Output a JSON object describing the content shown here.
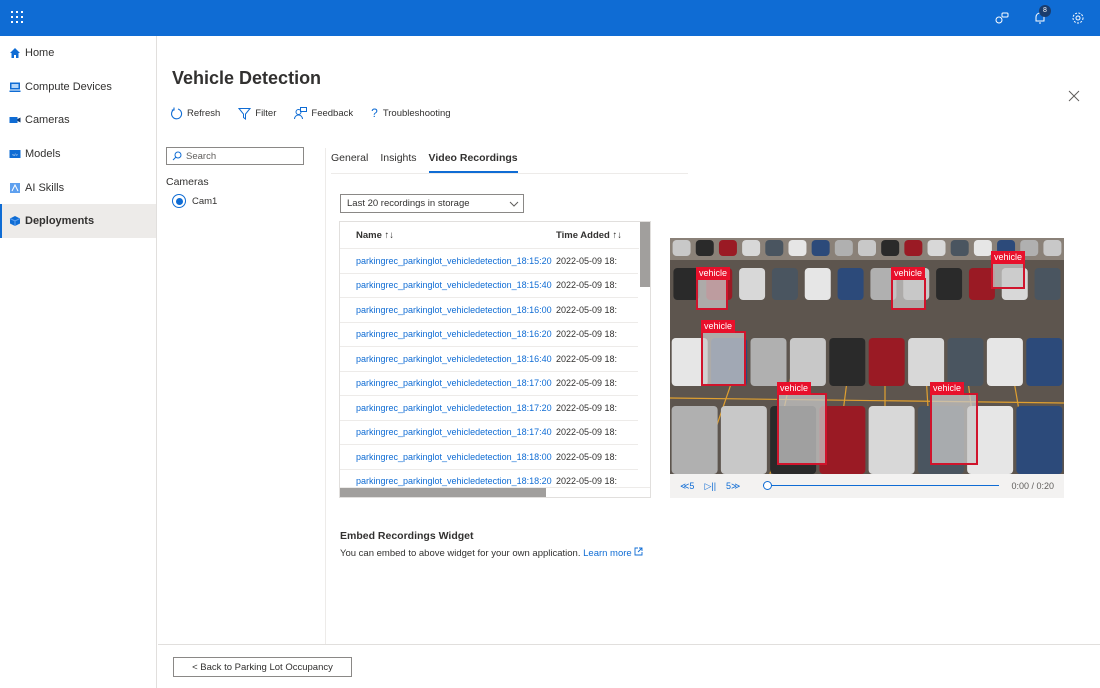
{
  "topbar": {
    "waffle_icon": "app-launcher-icon",
    "icons": [
      "chat-icon",
      "notification-bell-icon",
      "gear-icon"
    ],
    "notification_count": "8",
    "accent": "#0f6cd4"
  },
  "sidebar": {
    "items": [
      {
        "label": "Home",
        "icon": "home-icon",
        "active": false
      },
      {
        "label": "Compute Devices",
        "icon": "compute-device-icon",
        "active": false
      },
      {
        "label": "Cameras",
        "icon": "camera-icon",
        "active": false
      },
      {
        "label": "Models",
        "icon": "model-icon",
        "active": false
      },
      {
        "label": "AI Skills",
        "icon": "ai-skills-icon",
        "active": false
      },
      {
        "label": "Deployments",
        "icon": "deployments-icon",
        "active": true
      }
    ]
  },
  "page": {
    "title": "Vehicle Detection",
    "toolbar": {
      "refresh": "Refresh",
      "filter": "Filter",
      "feedback": "Feedback",
      "troubleshooting": "Troubleshooting"
    }
  },
  "left_panel": {
    "search_placeholder": "Search",
    "cameras_label": "Cameras",
    "cameras": [
      {
        "name": "Cam1",
        "selected": true
      }
    ]
  },
  "tabs": [
    {
      "label": "General",
      "active": false
    },
    {
      "label": "Insights",
      "active": false
    },
    {
      "label": "Video Recordings",
      "active": true
    }
  ],
  "recordings": {
    "filter_selected": "Last 20 recordings in storage",
    "columns": {
      "name": "Name ↑↓",
      "time": "Time Added ↑↓"
    },
    "rows": [
      {
        "name": "parkingrec_parkinglot_vehicledetection_18:15:20",
        "time": "2022-05-09 18:"
      },
      {
        "name": "parkingrec_parkinglot_vehicledetection_18:15:40",
        "time": "2022-05-09 18:"
      },
      {
        "name": "parkingrec_parkinglot_vehicledetection_18:16:00",
        "time": "2022-05-09 18:"
      },
      {
        "name": "parkingrec_parkinglot_vehicledetection_18:16:20",
        "time": "2022-05-09 18:"
      },
      {
        "name": "parkingrec_parkinglot_vehicledetection_18:16:40",
        "time": "2022-05-09 18:"
      },
      {
        "name": "parkingrec_parkinglot_vehicledetection_18:17:00",
        "time": "2022-05-09 18:"
      },
      {
        "name": "parkingrec_parkinglot_vehicledetection_18:17:20",
        "time": "2022-05-09 18:"
      },
      {
        "name": "parkingrec_parkinglot_vehicledetection_18:17:40",
        "time": "2022-05-09 18:"
      },
      {
        "name": "parkingrec_parkinglot_vehicledetection_18:18:00",
        "time": "2022-05-09 18:"
      },
      {
        "name": "parkingrec_parkinglot_vehicledetection_18:18:20",
        "time": "2022-05-09 18:"
      }
    ]
  },
  "video": {
    "detection_label": "vehicle",
    "detection_count": 6,
    "rewind_label": "≪5",
    "play_pause_label": "▷||",
    "forward_label": "5≫",
    "progress": 0,
    "time": "0:00 / 0:20",
    "box_color": "#d0142c"
  },
  "embed": {
    "title": "Embed Recordings Widget",
    "text": "You can embed to above widget for your own application.",
    "link": "Learn more"
  },
  "footer": {
    "back_button": "< Back to Parking Lot Occupancy"
  }
}
